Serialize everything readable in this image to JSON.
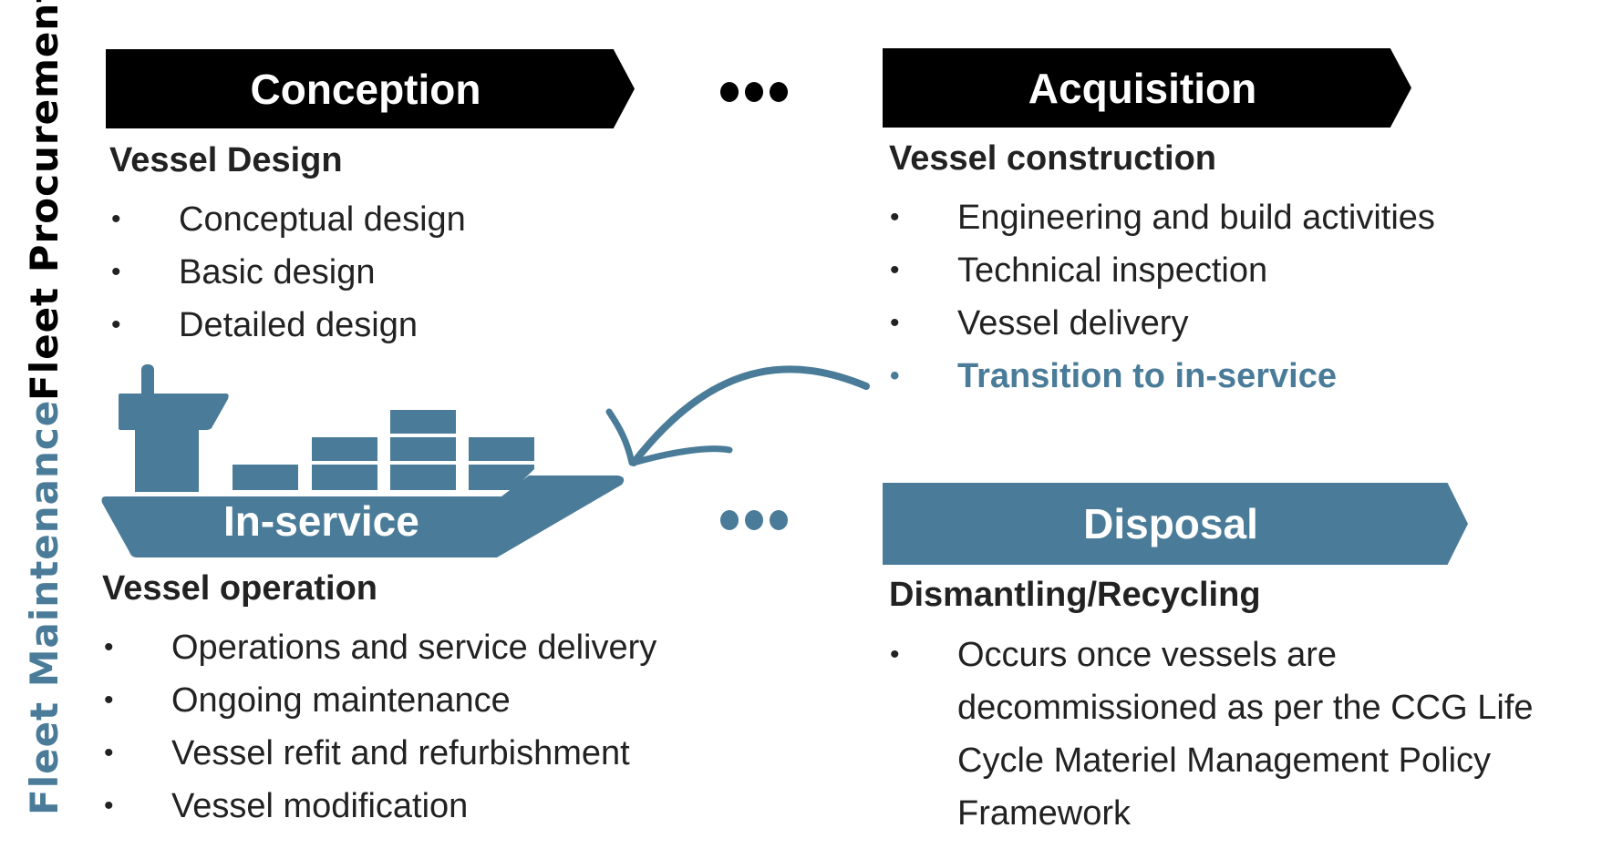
{
  "colors": {
    "accent": "#4a7c99",
    "dark": "#000000",
    "text": "#222222"
  },
  "side_labels": {
    "procurement": "Fleet Procurement",
    "maintenance": "Fleet Maintenance"
  },
  "phases": {
    "conception": {
      "banner": "Conception",
      "title": "Vessel Design",
      "items": [
        "Conceptual design",
        "Basic design",
        "Detailed design"
      ]
    },
    "acquisition": {
      "banner": "Acquisition",
      "title": "Vessel construction",
      "items": [
        "Engineering and build activities",
        "Technical inspection",
        "Vessel delivery",
        "Transition to in-service"
      ],
      "highlighted_item": "Transition to in-service"
    },
    "in_service": {
      "banner": "In-service",
      "title": "Vessel operation",
      "items": [
        "Operations and service delivery",
        "Ongoing maintenance",
        "Vessel refit and refurbishment",
        "Vessel modification"
      ]
    },
    "disposal": {
      "banner": "Disposal",
      "title": "Dismantling/Recycling",
      "items": [
        "Occurs once vessels are decommissioned as per the CCG Life Cycle Materiel Management Policy Framework"
      ]
    }
  },
  "connectors": {
    "top_ellipsis": "continuation-dots",
    "bottom_ellipsis": "continuation-dots",
    "arrow": "curved-arrow from Transition to in-service to In-service ship"
  },
  "icons": {
    "ship": "container-ship-icon"
  }
}
